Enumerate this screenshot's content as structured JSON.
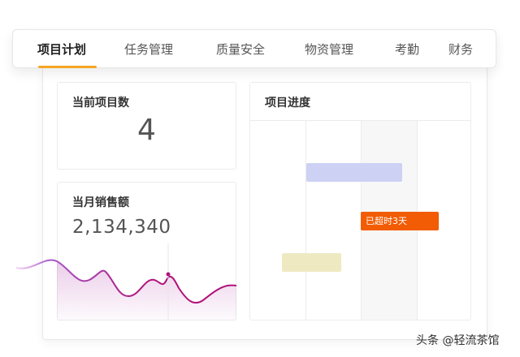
{
  "tabs": [
    {
      "label": "项目计划",
      "active": true
    },
    {
      "label": "任务管理",
      "active": false
    },
    {
      "label": "质量安全",
      "active": false
    },
    {
      "label": "物资管理",
      "active": false
    },
    {
      "label": "考勤",
      "active": false
    },
    {
      "label": "财务",
      "active": false
    }
  ],
  "accent_color": "#f5a623",
  "project_count": {
    "title": "当前项目数",
    "value": "4"
  },
  "monthly_sales": {
    "title": "当月销售额",
    "value": "2,134,340",
    "line_color": "#b0127a"
  },
  "project_progress": {
    "title": "项目进度",
    "overdue_label": "已超时3天",
    "overdue_color": "#f25c05"
  },
  "watermark": "头条 @轻流茶馆"
}
